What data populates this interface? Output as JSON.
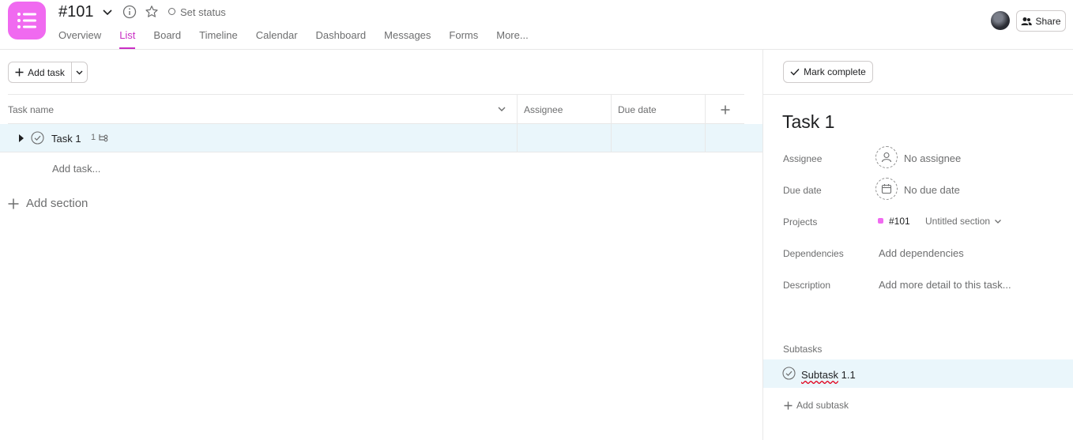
{
  "header": {
    "project_title": "#101",
    "status_label": "Set status",
    "tabs": [
      {
        "label": "Overview",
        "active": false
      },
      {
        "label": "List",
        "active": true
      },
      {
        "label": "Board",
        "active": false
      },
      {
        "label": "Timeline",
        "active": false
      },
      {
        "label": "Calendar",
        "active": false
      },
      {
        "label": "Dashboard",
        "active": false
      },
      {
        "label": "Messages",
        "active": false
      },
      {
        "label": "Forms",
        "active": false
      },
      {
        "label": "More..."
      }
    ],
    "share_label": "Share"
  },
  "list": {
    "add_task_label": "Add task",
    "columns": {
      "name": "Task name",
      "assignee": "Assignee",
      "due": "Due date"
    },
    "tasks": [
      {
        "name": "Task 1",
        "subtask_count": "1",
        "assignee": "",
        "due": ""
      }
    ],
    "add_task_placeholder": "Add task...",
    "add_section_label": "Add section"
  },
  "detail": {
    "mark_complete_label": "Mark complete",
    "title": "Task 1",
    "fields": {
      "assignee_label": "Assignee",
      "assignee_value": "No assignee",
      "due_label": "Due date",
      "due_value": "No due date",
      "projects_label": "Projects",
      "project_name": "#101",
      "project_section": "Untitled section",
      "dependencies_label": "Dependencies",
      "dependencies_value": "Add dependencies",
      "description_label": "Description",
      "description_value": "Add more detail to this task..."
    },
    "subtasks_label": "Subtasks",
    "subtasks": [
      {
        "word": "Subtask",
        "suffix": " 1.1"
      }
    ],
    "add_subtask_label": "Add subtask"
  },
  "colors": {
    "accent": "#c92fc4",
    "project": "#f06af0",
    "row_highlight": "#eaf6fb"
  }
}
